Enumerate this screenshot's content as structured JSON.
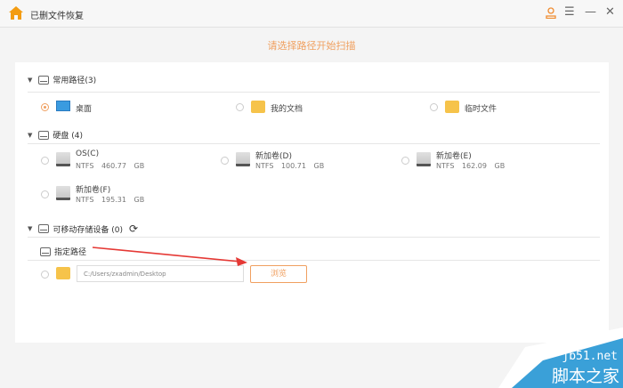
{
  "app": {
    "title": "已删文件恢复"
  },
  "subtitle": "请选择路径开始扫描",
  "common": {
    "label": "常用路径(3)",
    "items": [
      {
        "label": "桌面",
        "selected": true
      },
      {
        "label": "我的文档",
        "selected": false
      },
      {
        "label": "临时文件",
        "selected": false
      }
    ]
  },
  "disks": {
    "label": "硬盘 (4)",
    "items": [
      {
        "name": "OS(C)",
        "fs": "NTFS",
        "size": "460.77 GB"
      },
      {
        "name": "新加卷(D)",
        "fs": "NTFS",
        "size": "100.71 GB"
      },
      {
        "name": "新加卷(E)",
        "fs": "NTFS",
        "size": "162.09 GB"
      },
      {
        "name": "新加卷(F)",
        "fs": "NTFS",
        "size": "195.31 GB"
      }
    ]
  },
  "removable": {
    "label": "可移动存储设备 (0)"
  },
  "custom": {
    "label": "指定路径",
    "path": "C:/Users/zxadmin/Desktop",
    "browse": "浏览"
  },
  "watermark": {
    "line1": "jb51.net",
    "line2": "脚本之家"
  }
}
